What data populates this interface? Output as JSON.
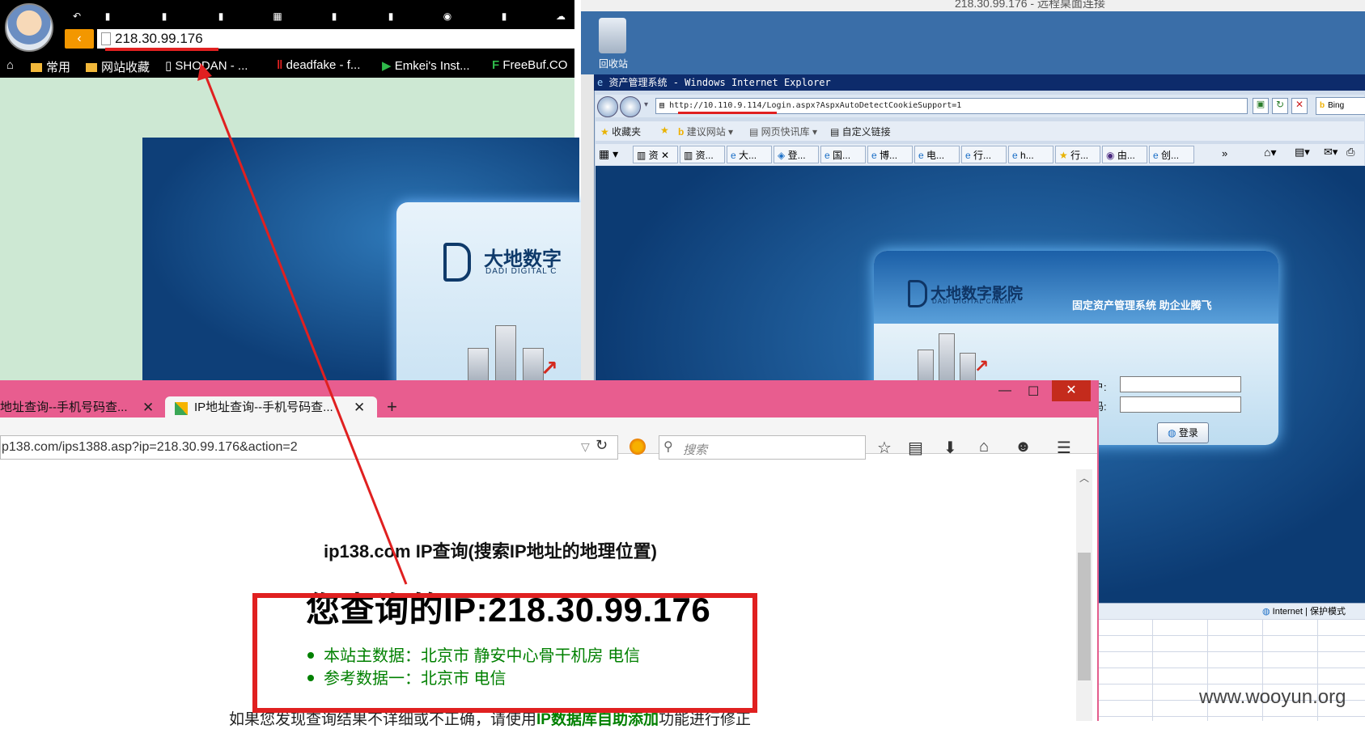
{
  "top_left_browser": {
    "address_url": "218.30.99.176",
    "bookmarks": [
      "常用",
      "网站收藏",
      "SHODAN - ...",
      "deadfake - f...",
      "Emkei's Inst...",
      "FreeBuf.CO"
    ],
    "logo_cn": "大地数字",
    "logo_en": "DADI DIGITAL C"
  },
  "remote_desktop": {
    "title": "218.30.99.176 - 远程桌面连接",
    "recycle_bin_label": "回收站",
    "ie": {
      "window_title": "资产管理系统 - Windows Internet Explorer",
      "url_prefix": "http://",
      "url_host": "10.110.9.114",
      "url_rest": "/Login.aspx?AspxAutoDetectCookieSupport=1",
      "search_label": "Bing",
      "favorites": [
        "收藏夹",
        "建议网站",
        "网页快讯库",
        "自定义链接"
      ],
      "tabs": [
        "资",
        "资...",
        "大...",
        "登...",
        "国...",
        "博...",
        "电...",
        "行...",
        "h...",
        "行...",
        "由...",
        "创..."
      ],
      "logo_cn": "大地数字影院",
      "logo_en": "DADI DIGITAL CINEMA",
      "slogan": "固定资产管理系统 助企业腾飞",
      "user_label": "用户:",
      "password_label": "密码:",
      "login_button": "登录",
      "status_zone": "Internet | 保护模式"
    }
  },
  "firefox": {
    "tab1_label": "地址查询--手机号码查...",
    "tab2_label": "IP地址查询--手机号码查...",
    "url": "p138.com/ips1388.asp?ip=218.30.99.176&action=2",
    "search_placeholder": "搜索",
    "page": {
      "heading": "ip138.com IP查询(搜索IP地址的地理位置)",
      "queried_ip": "您查询的IP:218.30.99.176",
      "results": [
        "本站主数据：北京市 静安中心骨干机房 电信",
        "参考数据一：北京市 电信"
      ],
      "hint_prefix": "如果您发现查询结果不详细或不正确，请使用",
      "hint_link": "IP数据库自助添加",
      "hint_suffix": "功能进行修正"
    }
  },
  "watermark": "www.wooyun.org",
  "colors": {
    "annotation_red": "#e02020",
    "firefox_frame": "#e85d8f",
    "result_green": "#008000"
  }
}
